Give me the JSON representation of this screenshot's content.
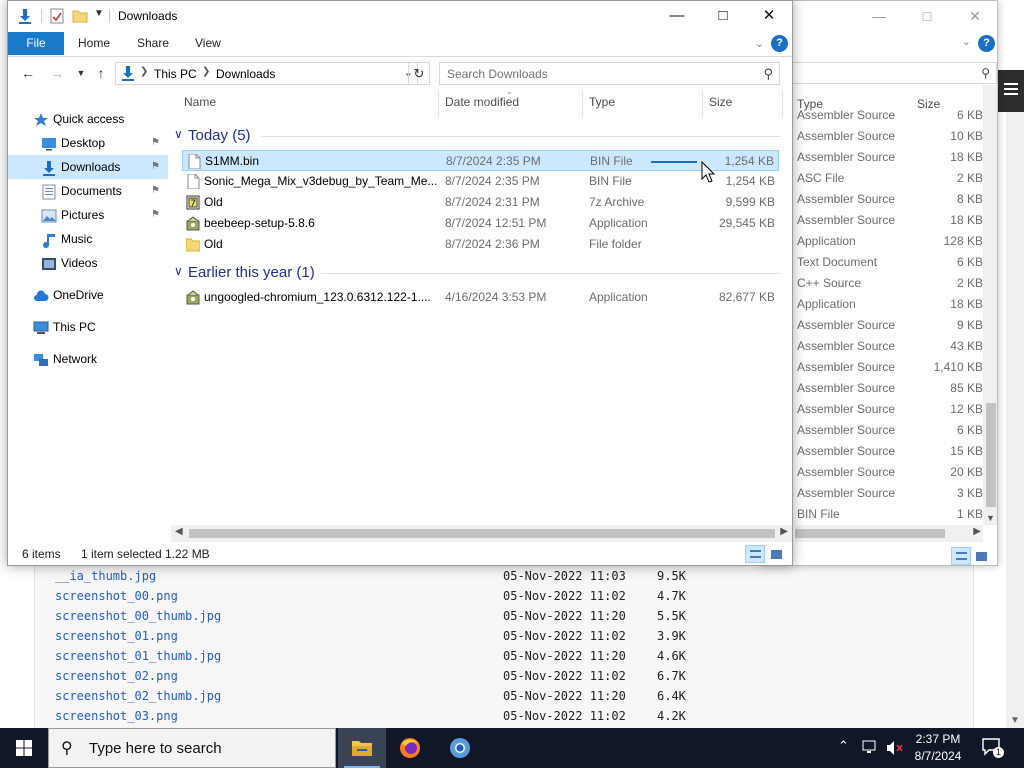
{
  "webpage": {
    "listing": [
      {
        "name": "__ia_thumb.jpg",
        "date": "05-Nov-2022 11:03",
        "size": "9.5K"
      },
      {
        "name": "screenshot_00.png",
        "date": "05-Nov-2022 11:02",
        "size": "4.7K"
      },
      {
        "name": "screenshot_00_thumb.jpg",
        "date": "05-Nov-2022 11:20",
        "size": "5.5K"
      },
      {
        "name": "screenshot_01.png",
        "date": "05-Nov-2022 11:02",
        "size": "3.9K"
      },
      {
        "name": "screenshot_01_thumb.jpg",
        "date": "05-Nov-2022 11:20",
        "size": "4.6K"
      },
      {
        "name": "screenshot_02.png",
        "date": "05-Nov-2022 11:02",
        "size": "6.7K"
      },
      {
        "name": "screenshot_02_thumb.jpg",
        "date": "05-Nov-2022 11:20",
        "size": "6.4K"
      },
      {
        "name": "screenshot_03.png",
        "date": "05-Nov-2022 11:02",
        "size": "4.2K"
      }
    ]
  },
  "bg_window": {
    "columns": {
      "type": "Type",
      "size": "Size"
    },
    "rows": [
      {
        "type": "Assembler Source",
        "size": "6 KB"
      },
      {
        "type": "Assembler Source",
        "size": "10 KB"
      },
      {
        "type": "Assembler Source",
        "size": "18 KB"
      },
      {
        "type": "ASC File",
        "size": "2 KB"
      },
      {
        "type": "Assembler Source",
        "size": "8 KB"
      },
      {
        "type": "Assembler Source",
        "size": "18 KB"
      },
      {
        "type": "Application",
        "size": "128 KB"
      },
      {
        "type": "Text Document",
        "size": "6 KB"
      },
      {
        "type": "C++ Source",
        "size": "2 KB"
      },
      {
        "type": "Application",
        "size": "18 KB"
      },
      {
        "type": "Assembler Source",
        "size": "9 KB"
      },
      {
        "type": "Assembler Source",
        "size": "43 KB"
      },
      {
        "type": "Assembler Source",
        "size": "1,410 KB"
      },
      {
        "type": "Assembler Source",
        "size": "85 KB"
      },
      {
        "type": "Assembler Source",
        "size": "12 KB"
      },
      {
        "type": "Assembler Source",
        "size": "6 KB"
      },
      {
        "type": "Assembler Source",
        "size": "15 KB"
      },
      {
        "type": "Assembler Source",
        "size": "20 KB"
      },
      {
        "type": "Assembler Source",
        "size": "3 KB"
      },
      {
        "type": "BIN File",
        "size": "1 KB"
      }
    ]
  },
  "window": {
    "title": "Downloads",
    "ribbon_tabs": {
      "file": "File",
      "home": "Home",
      "share": "Share",
      "view": "View"
    },
    "address": {
      "root": "This PC",
      "folder": "Downloads"
    },
    "search_placeholder": "Search Downloads",
    "nav": [
      {
        "label": "Quick access",
        "icon": "star-icon"
      },
      {
        "label": "Desktop",
        "icon": "desktop-icon",
        "pinned": true
      },
      {
        "label": "Downloads",
        "icon": "download-icon",
        "pinned": true,
        "selected": true
      },
      {
        "label": "Documents",
        "icon": "documents-icon",
        "pinned": true
      },
      {
        "label": "Pictures",
        "icon": "pictures-icon",
        "pinned": true
      },
      {
        "label": "Music",
        "icon": "music-icon"
      },
      {
        "label": "Videos",
        "icon": "videos-icon"
      },
      {
        "label": "OneDrive",
        "icon": "cloud-icon"
      },
      {
        "label": "This PC",
        "icon": "computer-icon"
      },
      {
        "label": "Network",
        "icon": "network-icon"
      }
    ],
    "columns": {
      "name": "Name",
      "date": "Date modified",
      "type": "Type",
      "size": "Size"
    },
    "groups": [
      {
        "label": "Today (5)",
        "files": [
          {
            "name": "S1MM.bin",
            "date": "8/7/2024 2:35 PM",
            "type": "BIN File",
            "size": "1,254 KB",
            "icon": "file-icon",
            "selected": true
          },
          {
            "name": "Sonic_Mega_Mix_v3debug_by_Team_Me...",
            "date": "8/7/2024 2:35 PM",
            "type": "BIN File",
            "size": "1,254 KB",
            "icon": "file-icon"
          },
          {
            "name": "Old",
            "date": "8/7/2024 2:31 PM",
            "type": "7z Archive",
            "size": "9,599 KB",
            "icon": "archive-icon"
          },
          {
            "name": "beebeep-setup-5.8.6",
            "date": "8/7/2024 12:51 PM",
            "type": "Application",
            "size": "29,545 KB",
            "icon": "installer-icon"
          },
          {
            "name": "Old",
            "date": "8/7/2024 2:36 PM",
            "type": "File folder",
            "size": "",
            "icon": "folder-icon"
          }
        ]
      },
      {
        "label": "Earlier this year (1)",
        "files": [
          {
            "name": "ungoogled-chromium_123.0.6312.122-1....",
            "date": "4/16/2024 3:53 PM",
            "type": "Application",
            "size": "82,677 KB",
            "icon": "installer-icon"
          }
        ]
      }
    ],
    "status": {
      "count": "6 items",
      "selection": "1 item selected",
      "size": "1.22 MB"
    }
  },
  "taskbar": {
    "search_placeholder": "Type here to search",
    "time": "2:37 PM",
    "date": "8/7/2024",
    "notification_count": "1"
  },
  "colors": {
    "accent": "#1979ca",
    "selection": "#cce8ff",
    "group_header": "#1e3287",
    "taskbar": "#101828"
  }
}
